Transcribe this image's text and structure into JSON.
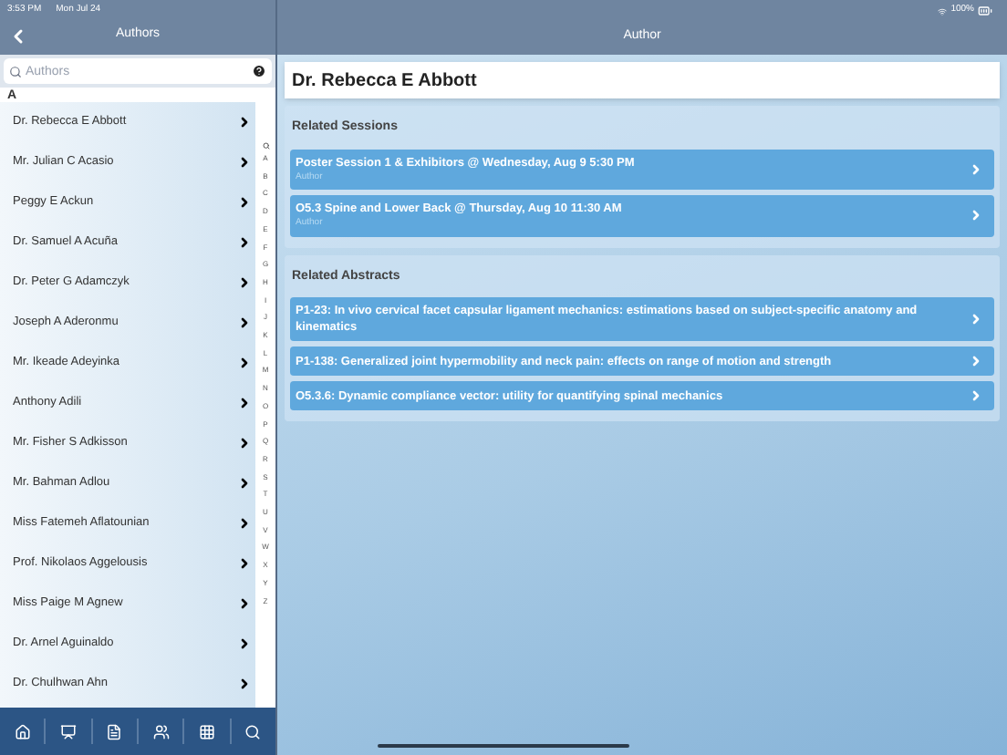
{
  "status_bar": {
    "time": "3:53 PM",
    "date": "Mon Jul 24",
    "battery": "100%"
  },
  "left_nav": {
    "title": "Authors"
  },
  "right_nav": {
    "title": "Author"
  },
  "search": {
    "placeholder": "Authors"
  },
  "section_header": "A",
  "authors": [
    {
      "name": "Dr. Rebecca E Abbott"
    },
    {
      "name": "Mr. Julian C Acasio"
    },
    {
      "name": "Peggy E Ackun"
    },
    {
      "name": "Dr. Samuel A Acuña"
    },
    {
      "name": "Dr. Peter G Adamczyk"
    },
    {
      "name": "Joseph A Aderonmu"
    },
    {
      "name": "Mr. Ikeade Adeyinka"
    },
    {
      "name": "Anthony Adili"
    },
    {
      "name": "Mr. Fisher S Adkisson"
    },
    {
      "name": "Mr. Bahman Adlou"
    },
    {
      "name": "Miss Fatemeh Aflatounian"
    },
    {
      "name": "Prof. Nikolaos Aggelousis"
    },
    {
      "name": "Miss Paige M Agnew"
    },
    {
      "name": "Dr. Arnel Aguinaldo"
    },
    {
      "name": "Dr. Chulhwan Ahn"
    }
  ],
  "index": [
    "A",
    "B",
    "C",
    "D",
    "E",
    "F",
    "G",
    "H",
    "I",
    "J",
    "K",
    "L",
    "M",
    "N",
    "O",
    "P",
    "Q",
    "R",
    "S",
    "T",
    "U",
    "V",
    "W",
    "X",
    "Y",
    "Z"
  ],
  "author_name": "Dr. Rebecca E Abbott",
  "sessions": {
    "title": "Related Sessions",
    "items": [
      {
        "title": "Poster Session 1 & Exhibitors @ Wednesday, Aug 9 5:30 PM",
        "role": "Author"
      },
      {
        "title": "O5.3 Spine and Lower Back @ Thursday, Aug 10 11:30 AM",
        "role": "Author"
      }
    ]
  },
  "abstracts": {
    "title": "Related Abstracts",
    "items": [
      {
        "title": "P1-23: In vivo cervical facet capsular ligament mechanics: estimations based on subject-specific anatomy and kinematics"
      },
      {
        "title": "P1-138: Generalized joint hypermobility and neck pain: effects on range of motion and strength"
      },
      {
        "title": "O5.3.6: Dynamic compliance vector: utility for quantifying spinal mechanics"
      }
    ]
  },
  "tab_bar": [
    {
      "kind": "home"
    },
    {
      "kind": "board"
    },
    {
      "kind": "document"
    },
    {
      "kind": "people"
    },
    {
      "kind": "grid"
    },
    {
      "kind": "search"
    }
  ]
}
